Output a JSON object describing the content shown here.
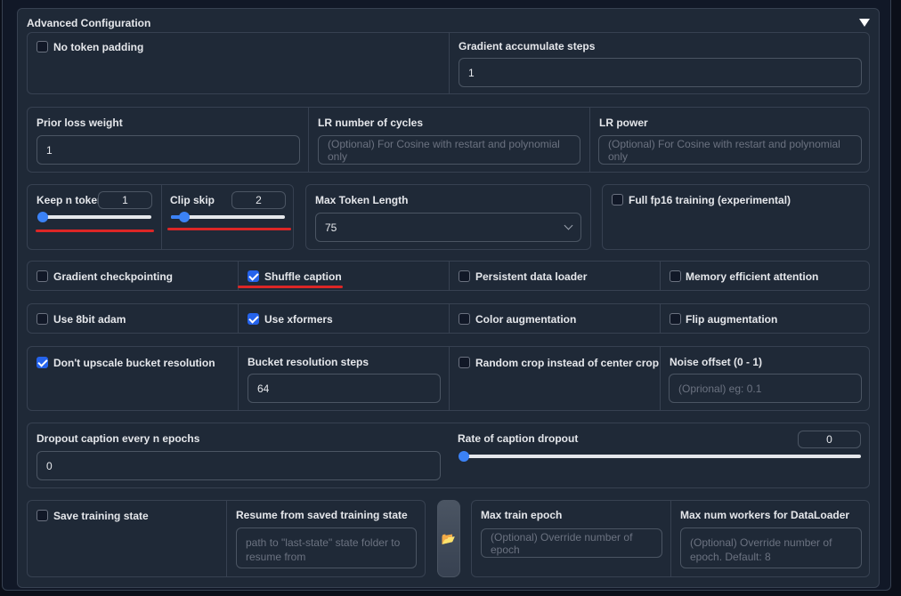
{
  "accordion": {
    "title": "Advanced Configuration"
  },
  "row1": {
    "no_token_padding": {
      "label": "No token padding",
      "checked": false
    },
    "gradient_accumulate_steps": {
      "label": "Gradient accumulate steps",
      "value": "1"
    }
  },
  "row2": {
    "prior_loss_weight": {
      "label": "Prior loss weight",
      "value": "1"
    },
    "lr_number_of_cycles": {
      "label": "LR number of cycles",
      "placeholder": "(Optional) For Cosine with restart and polynomial only"
    },
    "lr_power": {
      "label": "LR power",
      "placeholder": "(Optional) For Cosine with restart and polynomial only"
    }
  },
  "row3": {
    "keep_n_tokens": {
      "label": "Keep n tokens",
      "value": "1",
      "slider_fraction": 0.05
    },
    "clip_skip": {
      "label": "Clip skip",
      "value": "2",
      "slider_fraction": 0.1
    },
    "max_token_length": {
      "label": "Max Token Length",
      "value": "75"
    },
    "full_fp16": {
      "label": "Full fp16 training (experimental)",
      "checked": false
    }
  },
  "row4": {
    "gradient_checkpointing": {
      "label": "Gradient checkpointing",
      "checked": false
    },
    "shuffle_caption": {
      "label": "Shuffle caption",
      "checked": true
    },
    "persistent_data_loader": {
      "label": "Persistent data loader",
      "checked": false
    },
    "memory_efficient_attention": {
      "label": "Memory efficient attention",
      "checked": false
    }
  },
  "row5": {
    "use_8bit_adam": {
      "label": "Use 8bit adam",
      "checked": false
    },
    "use_xformers": {
      "label": "Use xformers",
      "checked": true
    },
    "color_augmentation": {
      "label": "Color augmentation",
      "checked": false
    },
    "flip_augmentation": {
      "label": "Flip augmentation",
      "checked": false
    }
  },
  "row6": {
    "dont_upscale": {
      "label": "Don't upscale bucket resolution",
      "checked": true
    },
    "bucket_resolution_steps": {
      "label": "Bucket resolution steps",
      "value": "64"
    },
    "random_crop": {
      "label": "Random crop instead of center crop",
      "checked": false
    },
    "noise_offset": {
      "label": "Noise offset (0 - 1)",
      "placeholder": "(Oprional) eg: 0.1"
    }
  },
  "row7": {
    "dropout_every_n_epochs": {
      "label": "Dropout caption every n epochs",
      "value": "0"
    },
    "caption_dropout_rate": {
      "label": "Rate of caption dropout",
      "value": "0",
      "slider_fraction": 0.0
    }
  },
  "row8": {
    "save_training_state": {
      "label": "Save training state",
      "checked": false
    },
    "resume_state": {
      "label": "Resume from saved training state",
      "placeholder": "path to \"last-state\" state folder to resume from"
    },
    "folder_button": {
      "icon": "📂"
    },
    "max_train_epoch": {
      "label": "Max train epoch",
      "placeholder": "(Optional) Override number of epoch"
    },
    "max_num_workers": {
      "label": "Max num workers for DataLoader",
      "placeholder": "(Optional) Override number of epoch. Default: 8"
    }
  },
  "colors": {
    "accent": "#3b82f6",
    "highlight": "#dc2626",
    "panel": "#1f2937",
    "border": "#374151"
  }
}
